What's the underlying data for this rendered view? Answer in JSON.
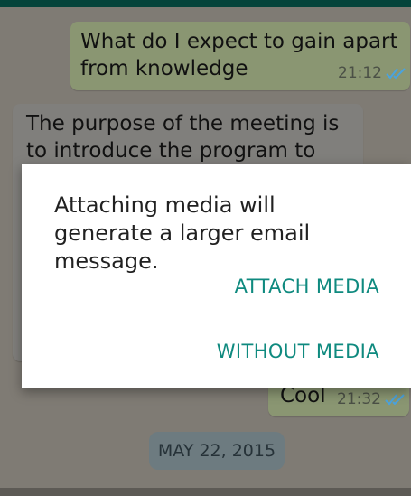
{
  "messages": [
    {
      "text": "What do I expect to gain apart from knowledge",
      "time": "21:12",
      "status": "read"
    },
    {
      "text": "The purpose of the meeting is to introduce the program to"
    },
    {
      "text": "Cool",
      "time": "21:32",
      "status": "read"
    }
  ],
  "date_separator": "MAY 22, 2015",
  "dialog": {
    "message": "Attaching media will generate a larger email message.",
    "attach_label": "ATTACH MEDIA",
    "without_label": "WITHOUT MEDIA"
  },
  "colors": {
    "accent": "#0f8a7f",
    "read_ticks": "#4aa3df"
  }
}
